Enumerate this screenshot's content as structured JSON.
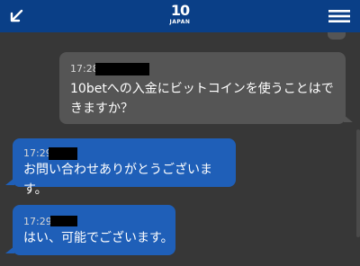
{
  "header": {
    "logo_mark": "10",
    "logo_sub": "JAPAN",
    "icons": [
      "minimize-arrow-icon",
      "hamburger-menu-icon"
    ],
    "color": "#0a3f87"
  },
  "messages": [
    {
      "direction": "incoming",
      "time": "17:28",
      "text": "10betへの入金にビットコインを使うことはできますか？"
    },
    {
      "direction": "outgoing",
      "time": "17:29",
      "text": "お問い合わせありがとうございます。"
    },
    {
      "direction": "outgoing",
      "time": "17:29",
      "text": "はい、可能でございます。"
    }
  ],
  "colors": {
    "background": "#373737",
    "incoming_bubble": "#555555",
    "outgoing_bubble": "#1f5fb8"
  }
}
